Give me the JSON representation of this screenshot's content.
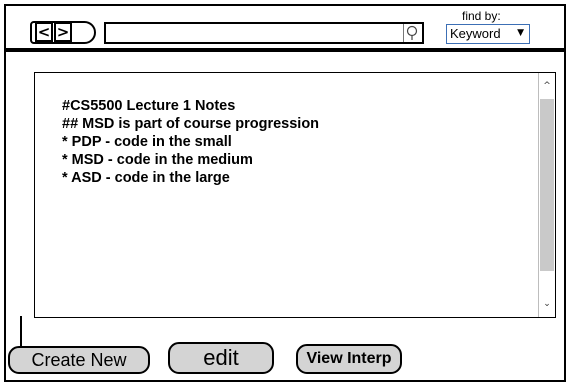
{
  "nav": {
    "back_label": "<",
    "forward_label": ">"
  },
  "search": {
    "value": "",
    "icon": "search-icon"
  },
  "find_by": {
    "label": "find by:",
    "selected": "Keyword",
    "arrow": "▼"
  },
  "notes": {
    "lines": [
      "#CS5500 Lecture 1 Notes",
      "## MSD is part of course progression",
      "* PDP - code in the small",
      "* MSD - code in the medium",
      "* ASD - code in the large"
    ]
  },
  "scrollbar": {
    "up": "^",
    "down": "⌄"
  },
  "buttons": {
    "create_new": "Create New",
    "edit": "edit",
    "view_interp": "View Interp"
  }
}
